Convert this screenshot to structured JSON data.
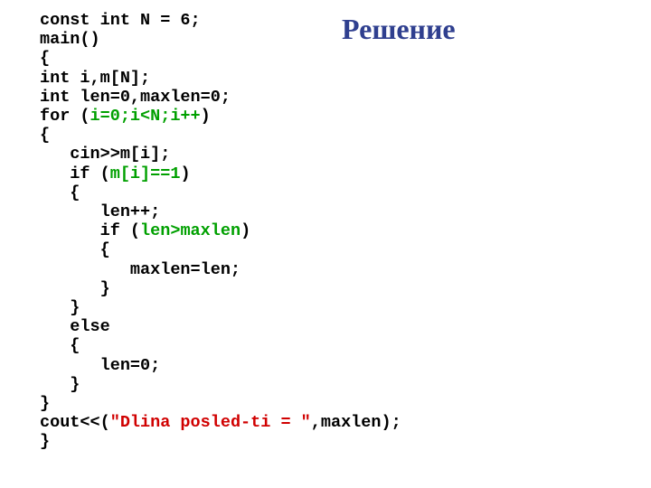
{
  "title": "Решение",
  "code": {
    "l01_a": "const int N = 6;",
    "l02_a": "main()",
    "l03_a": "{",
    "l04_a": "int i,m[N];",
    "l05_a": "int len=0,maxlen=0;",
    "l06_a": "for (",
    "l06_b": "i=0;i<N;i++",
    "l06_c": ")",
    "l07_a": "{",
    "l08_a": "   cin>>m[i];",
    "l09_a": "   if (",
    "l09_b": "m[i]==1",
    "l09_c": ")",
    "l10_a": "   {",
    "l11_a": "      len++;",
    "l12_a": "      if (",
    "l12_b": "len>maxlen",
    "l12_c": ")",
    "l13_a": "      {",
    "l14_a": "         maxlen=len;",
    "l15_a": "      }",
    "l16_a": "   }",
    "l17_a": "   else",
    "l18_a": "   {",
    "l19_a": "      len=0;",
    "l20_a": "   }",
    "l21_a": "}",
    "l22_a": "cout<<(",
    "l22_b": "\"Dlina posled-ti = \"",
    "l22_c": ",maxlen);",
    "l23_a": "}"
  }
}
